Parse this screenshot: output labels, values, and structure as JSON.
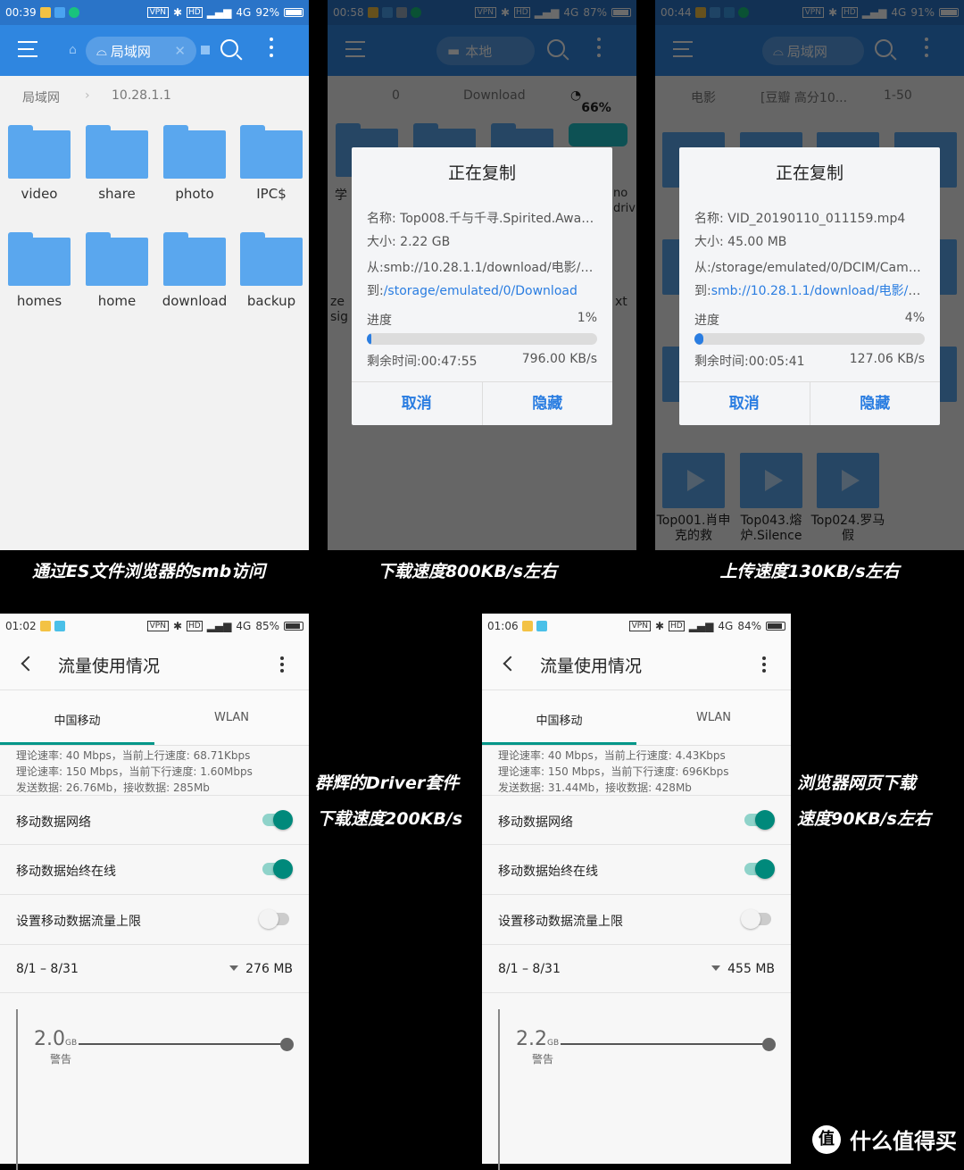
{
  "colors": {
    "toolbar": "#2f86e0",
    "accent": "#2a7de1",
    "toggle_on": "#009688"
  },
  "panel_es": {
    "status": {
      "time": "00:39",
      "battery": "92%",
      "network": "4G",
      "vpn": "VPN",
      "hd": "HD"
    },
    "chip": "局域网",
    "breadcrumb": [
      "局域网",
      "10.28.1.1"
    ],
    "folders": [
      "video",
      "share",
      "photo",
      "IPC$",
      "homes",
      "home",
      "download",
      "backup"
    ],
    "caption": "通过ES文件浏览器的smb访问"
  },
  "panel_download": {
    "status": {
      "time": "00:58",
      "battery": "87%",
      "network": "4G",
      "vpn": "VPN",
      "hd": "HD"
    },
    "chip": "本地",
    "breadcrumb": [
      "0",
      "Download"
    ],
    "storage": "66%",
    "bg_labels": [
      "学",
      "ze sig",
      "no driv",
      "xt"
    ],
    "dialog": {
      "title": "正在复制",
      "name": "名称: Top008.千与千寻.Spirited.Away.2...",
      "size": "大小: 2.22 GB",
      "from": "从:smb://10.28.1.1/download/电影/[豆...",
      "to_label": "到:",
      "to": "/storage/emulated/0/Download",
      "progress_label": "进度",
      "progress": "1%",
      "progress_value": 1,
      "remaining": "剩余时间:00:47:55",
      "speed": "796.00 KB/s",
      "cancel": "取消",
      "hide": "隐藏"
    },
    "caption": "下载速度800KB/s左右"
  },
  "panel_upload": {
    "status": {
      "time": "00:44",
      "battery": "91%",
      "network": "4G",
      "vpn": "VPN",
      "hd": "HD"
    },
    "chip": "局域网",
    "breadcrumb": [
      "电影",
      "[豆瓣 高分10...",
      "1-50"
    ],
    "videos": [
      "Top001.肖申克的救",
      "Top043.熔炉.Silence",
      "Top024.罗马假"
    ],
    "dialog": {
      "title": "正在复制",
      "name": "名称: VID_20190110_011159.mp4",
      "size": "大小: 45.00 MB",
      "from_label": "从:",
      "from": "/storage/emulated/0/DCIM/Camera/",
      "to_label": "到:",
      "to": "smb://10.28.1.1/download/电影/[豆...",
      "progress_label": "进度",
      "progress": "4%",
      "progress_value": 4,
      "remaining": "剩余时间:00:05:41",
      "speed": "127.06 KB/s",
      "cancel": "取消",
      "hide": "隐藏"
    },
    "caption": "上传速度130KB/s左右"
  },
  "usage1": {
    "status": {
      "time": "01:02",
      "battery": "85%",
      "network": "4G",
      "vpn": "VPN",
      "hd": "HD"
    },
    "title": "流量使用情况",
    "tabs": [
      "中国移动",
      "WLAN"
    ],
    "stats": [
      "理论速率:  40 Mbps，当前上行速度:  68.71Kbps",
      "理论速率:  150 Mbps，当前下行速度:  1.60Mbps",
      "发送数据:  26.76Mb，接收数据:  285Mb"
    ],
    "rows": [
      {
        "label": "移动数据网络",
        "on": true
      },
      {
        "label": "移动数据始终在线",
        "on": true
      },
      {
        "label": "设置移动数据流量上限",
        "on": false
      }
    ],
    "period": "8/1 – 8/31",
    "used": "276 MB",
    "warning_value": "2.0",
    "warning_unit": "GB",
    "warning_label": "警告"
  },
  "usage2": {
    "status": {
      "time": "01:06",
      "battery": "84%",
      "network": "4G",
      "vpn": "VPN",
      "hd": "HD"
    },
    "title": "流量使用情况",
    "tabs": [
      "中国移动",
      "WLAN"
    ],
    "stats": [
      "理论速率:  40 Mbps，当前上行速度:  4.43Kbps",
      "理论速率:  150 Mbps，当前下行速度:  696Kbps",
      "发送数据:  31.44Mb，接收数据:  428Mb"
    ],
    "rows": [
      {
        "label": "移动数据网络",
        "on": true
      },
      {
        "label": "移动数据始终在线",
        "on": true
      },
      {
        "label": "设置移动数据流量上限",
        "on": false
      }
    ],
    "period": "8/1 – 8/31",
    "used": "455 MB",
    "warning_value": "2.2",
    "warning_unit": "GB",
    "warning_label": "警告"
  },
  "captions_mid": [
    "群辉的Driver套件",
    "下载速度200KB/s"
  ],
  "captions_right": [
    "浏览器网页下载",
    "速度90KB/s左右"
  ],
  "watermark": "什么值得买"
}
